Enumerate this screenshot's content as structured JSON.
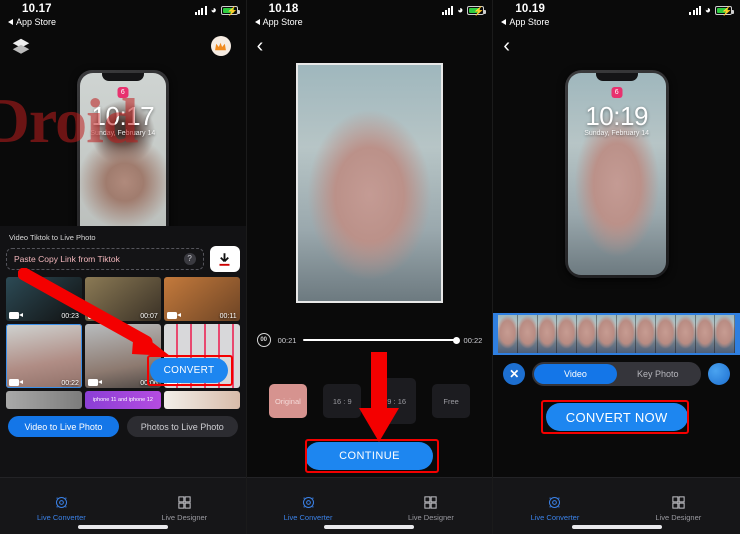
{
  "watermark": "BellyDroid",
  "panels": [
    {
      "id": "panel-1",
      "status": {
        "time": "10.17",
        "back_label": "App Store"
      },
      "lockscreen": {
        "time": "10:17",
        "date": "Sunday, February 14",
        "badge": "6"
      },
      "sheet": {
        "title": "Video Tiktok to Live Photo",
        "paste_placeholder": "Paste Copy Link from Tiktok",
        "help_label": "?",
        "thumbs": [
          {
            "duration": "00:23"
          },
          {
            "duration": "00:07"
          },
          {
            "duration": "00:11"
          },
          {
            "duration": "00:22"
          },
          {
            "duration": "00:06"
          },
          {
            "duration": ""
          },
          {
            "duration": ""
          },
          {
            "overlay": "iphone 11 and iphone 12"
          },
          {
            "duration": ""
          }
        ],
        "modes": [
          {
            "label": "Video to Live Photo",
            "active": true
          },
          {
            "label": "Photos to Live Photo",
            "active": false
          }
        ]
      },
      "convert_button": "CONVERT",
      "tabs": [
        {
          "label": "Live Converter",
          "icon": "live-converter-icon",
          "active": true
        },
        {
          "label": "Live Designer",
          "icon": "live-designer-icon",
          "active": false
        }
      ]
    },
    {
      "id": "panel-2",
      "status": {
        "time": "10.18",
        "back_label": "App Store"
      },
      "timeline": {
        "start": "00:21",
        "end": "00:22",
        "speed_icon": "00"
      },
      "ratios": [
        {
          "label": "Original",
          "selected": true
        },
        {
          "label": "16 : 9",
          "selected": false
        },
        {
          "label": "9 : 16",
          "selected": false
        },
        {
          "label": "Free",
          "selected": false
        }
      ],
      "continue_button": "CONTINUE",
      "tabs": [
        {
          "label": "Live Converter",
          "icon": "live-converter-icon",
          "active": true
        },
        {
          "label": "Live Designer",
          "icon": "live-designer-icon",
          "active": false
        }
      ]
    },
    {
      "id": "panel-3",
      "status": {
        "time": "10.19",
        "back_label": "App Store"
      },
      "lockscreen": {
        "time": "10:19",
        "date": "Sunday, February 14",
        "badge": "6"
      },
      "segments": [
        {
          "label": "Video",
          "active": true
        },
        {
          "label": "Key Photo",
          "active": false
        }
      ],
      "close_label": "✕",
      "convert_now_button": "CONVERT NOW",
      "tabs": [
        {
          "label": "Live Converter",
          "icon": "live-converter-icon",
          "active": true
        },
        {
          "label": "Live Designer",
          "icon": "live-designer-icon",
          "active": false
        }
      ]
    }
  ]
}
